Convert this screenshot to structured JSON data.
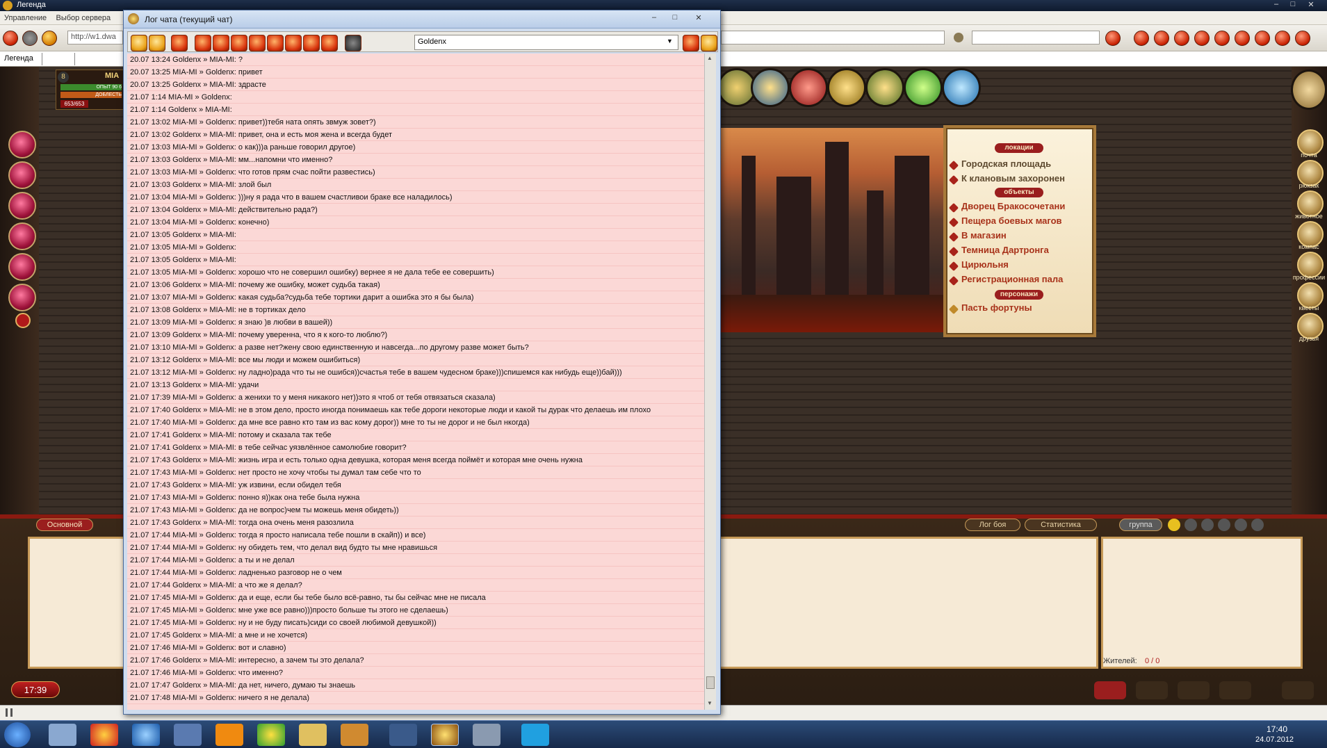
{
  "app": {
    "title": "Легенда"
  },
  "menu": [
    "Управление",
    "Выбор сервера"
  ],
  "browser": {
    "address": "http://w1.dwa",
    "tab": "Легенда"
  },
  "player": {
    "level": "8",
    "name": "MIA",
    "bar1": "ОПЫТ 90 6",
    "bar2": "ДОБЛЕСТЬ",
    "hp": "653/653"
  },
  "chat_window": {
    "title": "Лог чата (текущий чат)",
    "filter_value": "Goldenx",
    "rows": [
      "20.07 13:24  Goldenx » MIA-MI: ?",
      "20.07 13:25  MIA-MI » Goldenx: привет",
      "20.07 13:25  Goldenx » MIA-MI: здрасте",
      "21.07 1:14   MIA-MI » Goldenx:",
      "21.07 1:14   Goldenx » MIA-MI:",
      "21.07 13:02  MIA-MI » Goldenx: привет))тебя ната опять  звмуж зовет?)",
      "21.07 13:02  Goldenx » MIA-MI: привет, она и есть моя жена и всегда будет",
      "21.07 13:03  MIA-MI » Goldenx: о как)))а раньше говорил другое)",
      "21.07 13:03  Goldenx » MIA-MI: мм...напомни что именно?",
      "21.07 13:03  MIA-MI » Goldenx: что готов прям счас пойти развестись)",
      "21.07 13:03  Goldenx » MIA-MI: злой был",
      "21.07 13:04  MIA-MI » Goldenx: )))ну я рада что в вашем счастливои браке все наладилось)",
      "21.07 13:04  Goldenx » MIA-MI: действительно рада?)",
      "21.07 13:04  MIA-MI » Goldenx: конечно)",
      "21.07 13:05  Goldenx » MIA-MI:",
      "21.07 13:05  MIA-MI » Goldenx:",
      "21.07 13:05  Goldenx » MIA-MI:",
      "21.07 13:05  MIA-MI » Goldenx: хорошо что не совершил ошибку) вернее я не дала тебе ее совершить)",
      "21.07 13:06  Goldenx » MIA-MI: почему же ошибку, может судьба такая)",
      "21.07 13:07  MIA-MI » Goldenx: какая судьба?судьба тебе тортики дарит а ошибка это я бы была)",
      "21.07 13:08  Goldenx » MIA-MI: не в тортиках дело",
      "21.07 13:09  MIA-MI » Goldenx: я знаю )в любви в вашей))",
      "21.07 13:09  Goldenx » MIA-MI: почему уверенна, что я к кого-то люблю?)",
      "21.07 13:10  MIA-MI » Goldenx: а разве нет?жену свою единственную и навсегда...по другому разве может быть?",
      "21.07 13:12  Goldenx » MIA-MI: все мы люди и можем ошибиться)",
      "21.07 13:12  MIA-MI » Goldenx: ну ладно)рада что ты не ошибся))счастья тебе в вашем чудесном браке)))спишемся как нибудь еще))бай)))",
      "21.07 13:13  Goldenx » MIA-MI: удачи",
      "21.07 17:39  MIA-MI » Goldenx: а женихи то у меня никакого нет))это я чтоб от тебя отвязаться сказала)",
      "21.07 17:40  Goldenx » MIA-MI: не в этом дело, просто иногда понимаешь как тебе дороги некоторые люди и какой ты дурак что делаешь им плохо",
      "21.07 17:40  MIA-MI » Goldenx: да мне все равно кто там из вас кому дорог)) мне то ты не дорог и не был нкогда)",
      "21.07 17:41  Goldenx » MIA-MI: потому и сказала так тебе",
      "21.07 17:41  Goldenx » MIA-MI: в тебе сейчас уязвлённое самолюбие говорит?",
      "21.07 17:43  Goldenx » MIA-MI: жизнь игра и есть только одна девушка, которая меня всегда поймёт и которая мне очень нужна",
      "21.07 17:43  MIA-MI » Goldenx: нет просто не хочу чтобы ты думал там себе что то",
      "21.07 17:43  Goldenx » MIA-MI: уж извини, если обидел тебя",
      "21.07 17:43  MIA-MI » Goldenx: понно я))как она тебе была нужна",
      "21.07 17:43  MIA-MI » Goldenx: да не вопрос)чем ты можешь меня обидеть))",
      "21.07 17:43  Goldenx » MIA-MI: тогда она очень меня разозлила",
      "21.07 17:44  MIA-MI » Goldenx: тогда я просто написала тебе пошли в скайп)) и все)",
      "21.07 17:44  MIA-MI » Goldenx: ну обидеть тем, что делал вид будто ты мне нравишься",
      "21.07 17:44  MIA-MI » Goldenx: а ты и не делал",
      "21.07 17:44  MIA-MI » Goldenx: ладненько разговор не о чем",
      "21.07 17:44  Goldenx » MIA-MI: а что же я делал?",
      "21.07 17:45  MIA-MI » Goldenx: да и еще, если бы тебе было всё-равно, ты бы сейчас мне не писала",
      "21.07 17:45  MIA-MI » Goldenx: мне уже все равно)))просто больше ты этого не сделаешь)",
      "21.07 17:45  MIA-MI » Goldenx: ну и не буду писать)сиди со своей любимой девушкой))",
      "21.07 17:45  Goldenx » MIA-MI: а мне и не хочется)",
      "21.07 17:46  MIA-MI » Goldenx: вот и славно)",
      "21.07 17:46  Goldenx » MIA-MI: интересно, а зачем ты это делала?",
      "21.07 17:46  MIA-MI » Goldenx: что именно?",
      "21.07 17:47  Goldenx » MIA-MI: да нет, ничего, думаю ты знаешь",
      "21.07 17:48  MIA-MI » Goldenx: ничего я не делала)"
    ]
  },
  "locations": {
    "header_locations": "локации",
    "header_objects": "объекты",
    "header_characters": "персонажи",
    "locs": [
      "Городская площадь",
      "К клановым захоронен"
    ],
    "objects": [
      "Дворец Бракосочетани",
      "Пещера боевых магов",
      "В магазин",
      "Темница Дартронга",
      "Цирюльня",
      "Регистрационная пала"
    ],
    "characters": [
      "Пасть фортуны"
    ]
  },
  "right_orbs": [
    "почта",
    "рюкзак",
    "животное",
    "компас",
    "профессии",
    "квесты",
    "друзья"
  ],
  "bottom": {
    "tab_main": "Основной",
    "tab_battle_log": "Лог боя",
    "tab_stats": "Статистика",
    "tab_group": "группа",
    "residents_label": "Жителей:",
    "residents_value": "0 / 0"
  },
  "clock": "17:39",
  "systray": {
    "time": "17:40",
    "date": "24.07.2012"
  },
  "colors": {
    "chat_bg": "#fbd8d6",
    "accent_red": "#9a1e1e",
    "frame_gold": "#c79a58"
  }
}
